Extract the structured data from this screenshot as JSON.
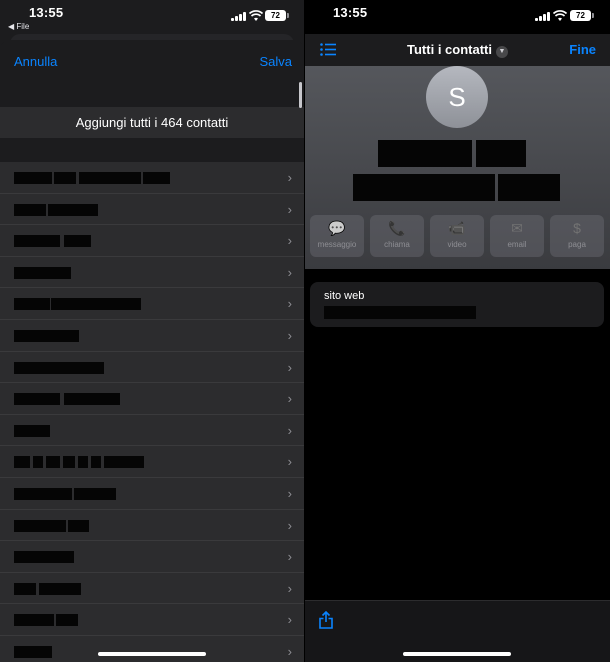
{
  "left": {
    "status": {
      "time": "13:55",
      "back": "◀ File",
      "battery": "72"
    },
    "nav": {
      "cancel": "Annulla",
      "save": "Salva"
    },
    "add_all": "Aggiungi tutti i 464 contatti",
    "rows_count_visible": 16,
    "chevron": "›"
  },
  "right": {
    "status": {
      "time": "13:55",
      "battery": "72"
    },
    "nav": {
      "title": "Tutti i contatti",
      "done": "Fine",
      "dropdown_icon": "chevron-down-icon",
      "list_icon": "list-icon"
    },
    "avatar_initial": "S",
    "actions": [
      {
        "label": "messaggio",
        "icon": "message-icon",
        "glyph": "💬"
      },
      {
        "label": "chiama",
        "icon": "phone-icon",
        "glyph": "📞"
      },
      {
        "label": "video",
        "icon": "video-icon",
        "glyph": "📹"
      },
      {
        "label": "email",
        "icon": "mail-icon",
        "glyph": "✉"
      },
      {
        "label": "paga",
        "icon": "dollar-icon",
        "glyph": "$"
      }
    ],
    "website_label": "sito web",
    "share_icon": "share-icon"
  },
  "colors": {
    "accent": "#0a84ff",
    "sheet": "#1c1c1e",
    "row": "#2c2c2e"
  }
}
